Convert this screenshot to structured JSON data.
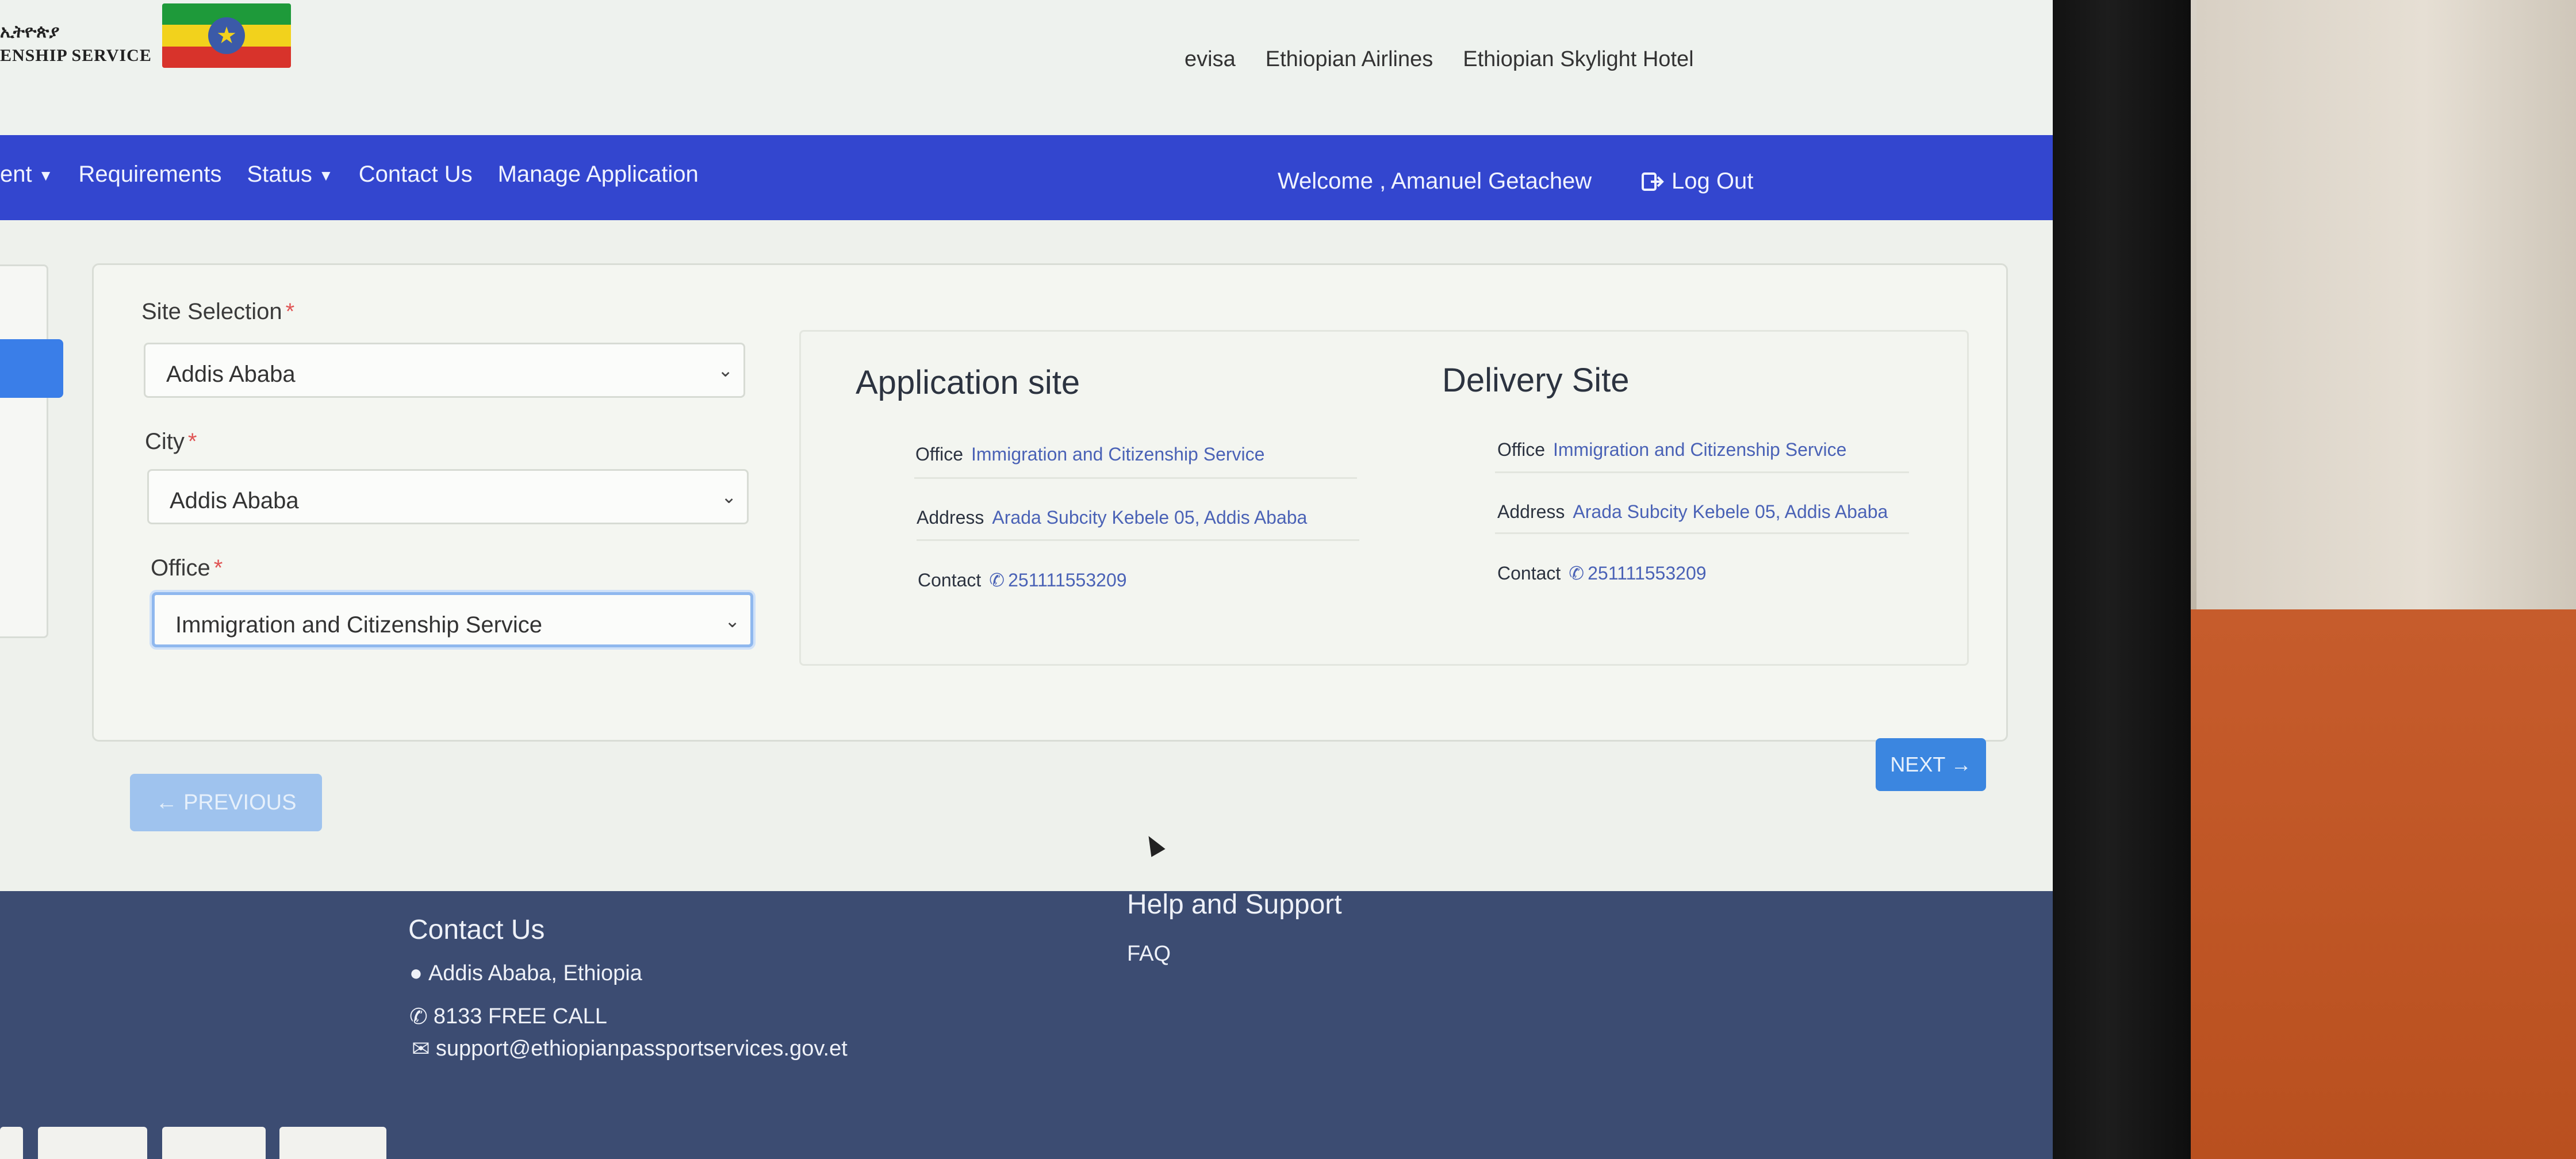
{
  "brand": {
    "amharic": "ኢትዮጵያ",
    "name": "ENSHIP SERVICE"
  },
  "top_links": [
    "evisa",
    "Ethiopian Airlines",
    "Ethiopian Skylight Hotel"
  ],
  "nav": {
    "items": [
      {
        "label": "ent",
        "dropdown": true
      },
      {
        "label": "Requirements",
        "dropdown": false
      },
      {
        "label": "Status",
        "dropdown": true
      },
      {
        "label": "Contact Us",
        "dropdown": false
      },
      {
        "label": "Manage Application",
        "dropdown": false
      }
    ],
    "welcome": "Welcome , Amanuel Getachew",
    "logout": "Log Out"
  },
  "form": {
    "site": {
      "label": "Site Selection",
      "value": "Addis Ababa"
    },
    "city": {
      "label": "City",
      "value": "Addis Ababa"
    },
    "office": {
      "label": "Office",
      "value": "Immigration and Citizenship Service"
    },
    "required_mark": "*"
  },
  "application_site": {
    "title": "Application site",
    "office_label": "Office",
    "office": "Immigration and Citizenship Service",
    "address_label": "Address",
    "address": "Arada Subcity Kebele 05, Addis Ababa",
    "contact_label": "Contact",
    "contact": "251111553209"
  },
  "delivery_site": {
    "title": "Delivery Site",
    "office_label": "Office",
    "office": "Immigration and Citizenship Service",
    "address_label": "Address",
    "address": "Arada Subcity Kebele 05, Addis Ababa",
    "contact_label": "Contact",
    "contact": "251111553209"
  },
  "buttons": {
    "previous": "← PREVIOUS",
    "next": "NEXT →"
  },
  "footer": {
    "contact_title": "Contact Us",
    "location": "Addis Ababa, Ethiopia",
    "phone": "8133 FREE CALL",
    "email": "support@ethiopianpassportservices.gov.et",
    "help_title": "Help and Support",
    "faq": "FAQ"
  },
  "colors": {
    "navbar": "#3346cf",
    "primary_button": "#3b86e0",
    "footer": "#3c4c72"
  }
}
